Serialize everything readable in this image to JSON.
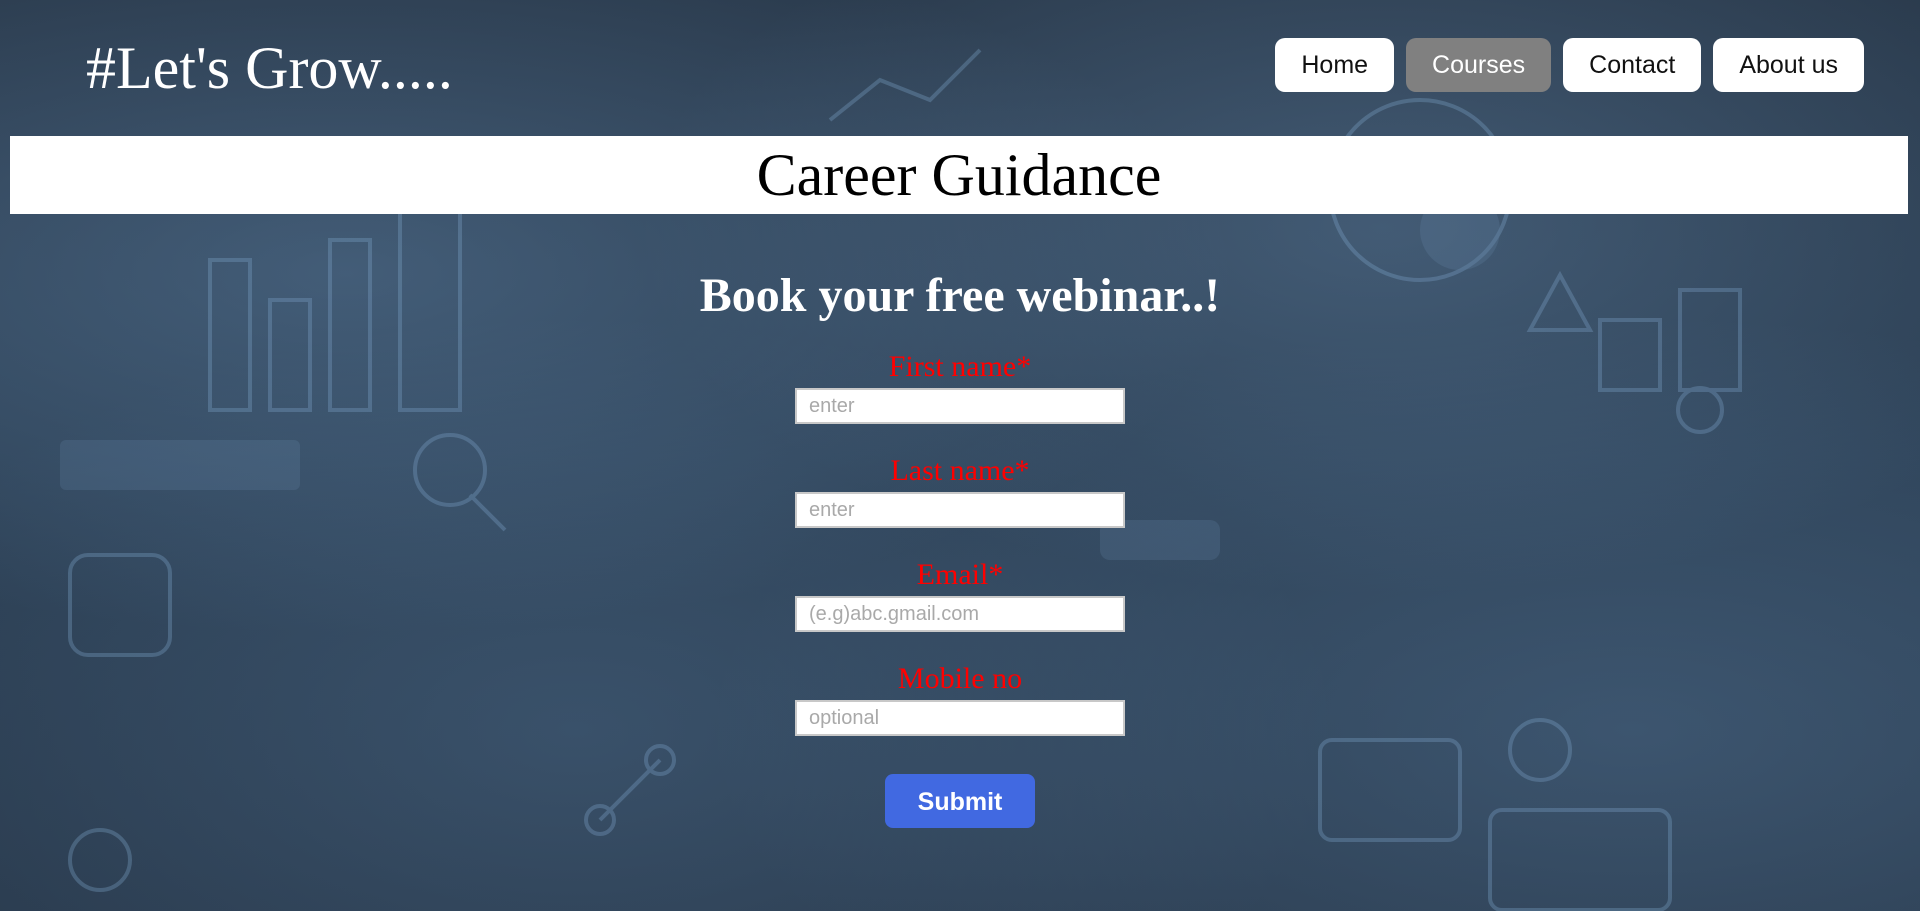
{
  "header": {
    "brand": "#Let's Grow.....",
    "nav": [
      {
        "label": "Home",
        "active": false
      },
      {
        "label": "Courses",
        "active": true
      },
      {
        "label": "Contact",
        "active": false
      },
      {
        "label": "About us",
        "active": false
      }
    ]
  },
  "title_bar": {
    "title": "Career Guidance"
  },
  "main": {
    "heading": "Book your free webinar..!",
    "fields": [
      {
        "label": "First name*",
        "placeholder": "enter"
      },
      {
        "label": "Last name*",
        "placeholder": "enter"
      },
      {
        "label": "Email*",
        "placeholder": "(e.g)abc.gmail.com"
      },
      {
        "label": "Mobile no",
        "placeholder": "optional"
      }
    ],
    "submit_label": "Submit"
  },
  "colors": {
    "label_red": "#ff0000",
    "submit_blue": "#4169e1",
    "nav_active_gray": "#808080",
    "background_navy": "#2d4156"
  },
  "icons": {
    "background": "technology-doodle-background-image"
  }
}
